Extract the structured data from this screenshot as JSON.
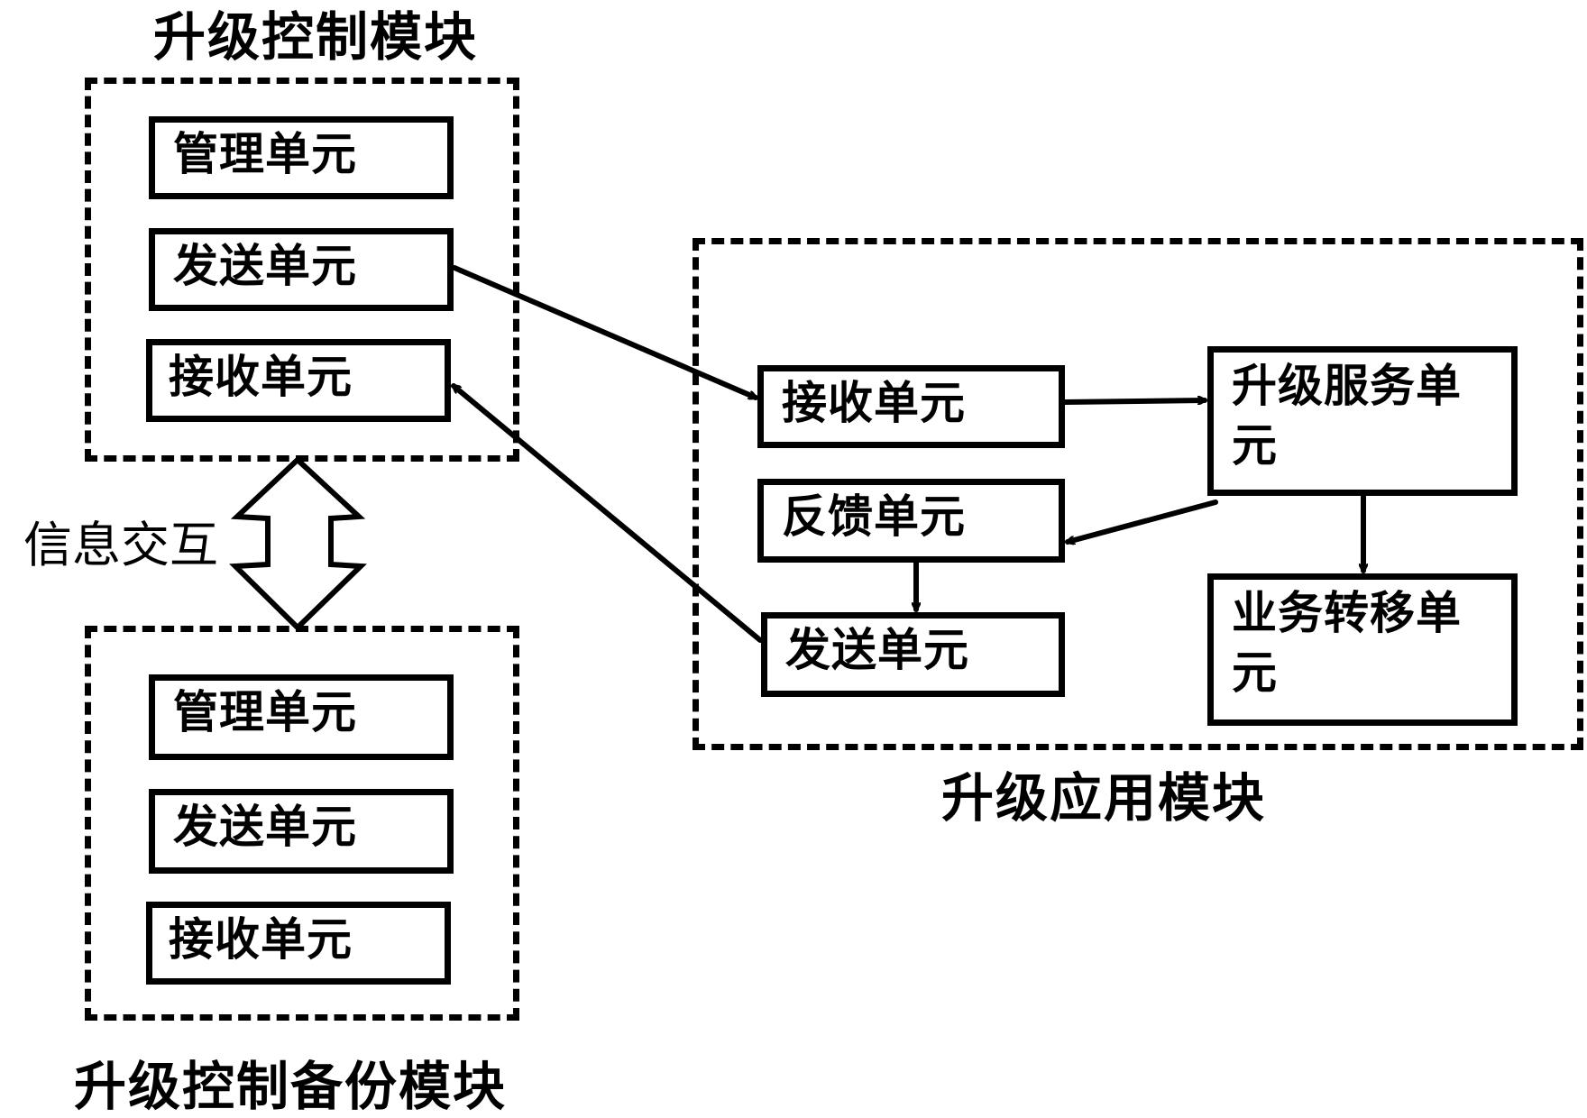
{
  "modules": {
    "control": {
      "title": "升级控制模块",
      "units": [
        "管理单元",
        "发送单元",
        "接收单元"
      ]
    },
    "backup": {
      "title": "升级控制备份模块",
      "units": [
        "管理单元",
        "发送单元",
        "接收单元"
      ]
    },
    "application": {
      "title": "升级应用模块",
      "units": {
        "receive": "接收单元",
        "feedback": "反馈单元",
        "send": "发送单元",
        "upgrade_service": "升级服务单元",
        "service_transfer": "业务转移单元"
      }
    }
  },
  "interaction_label": "信息交互",
  "connections": [
    {
      "from": "control.send",
      "to": "application.receive"
    },
    {
      "from": "application.send",
      "to": "control.receive"
    },
    {
      "from": "application.receive",
      "to": "application.upgrade_service"
    },
    {
      "from": "application.upgrade_service",
      "to": "application.feedback"
    },
    {
      "from": "application.upgrade_service",
      "to": "application.service_transfer"
    },
    {
      "from": "application.feedback",
      "to": "application.send"
    },
    {
      "from": "control",
      "to": "backup",
      "bidirectional": true,
      "label": "信息交互"
    }
  ]
}
